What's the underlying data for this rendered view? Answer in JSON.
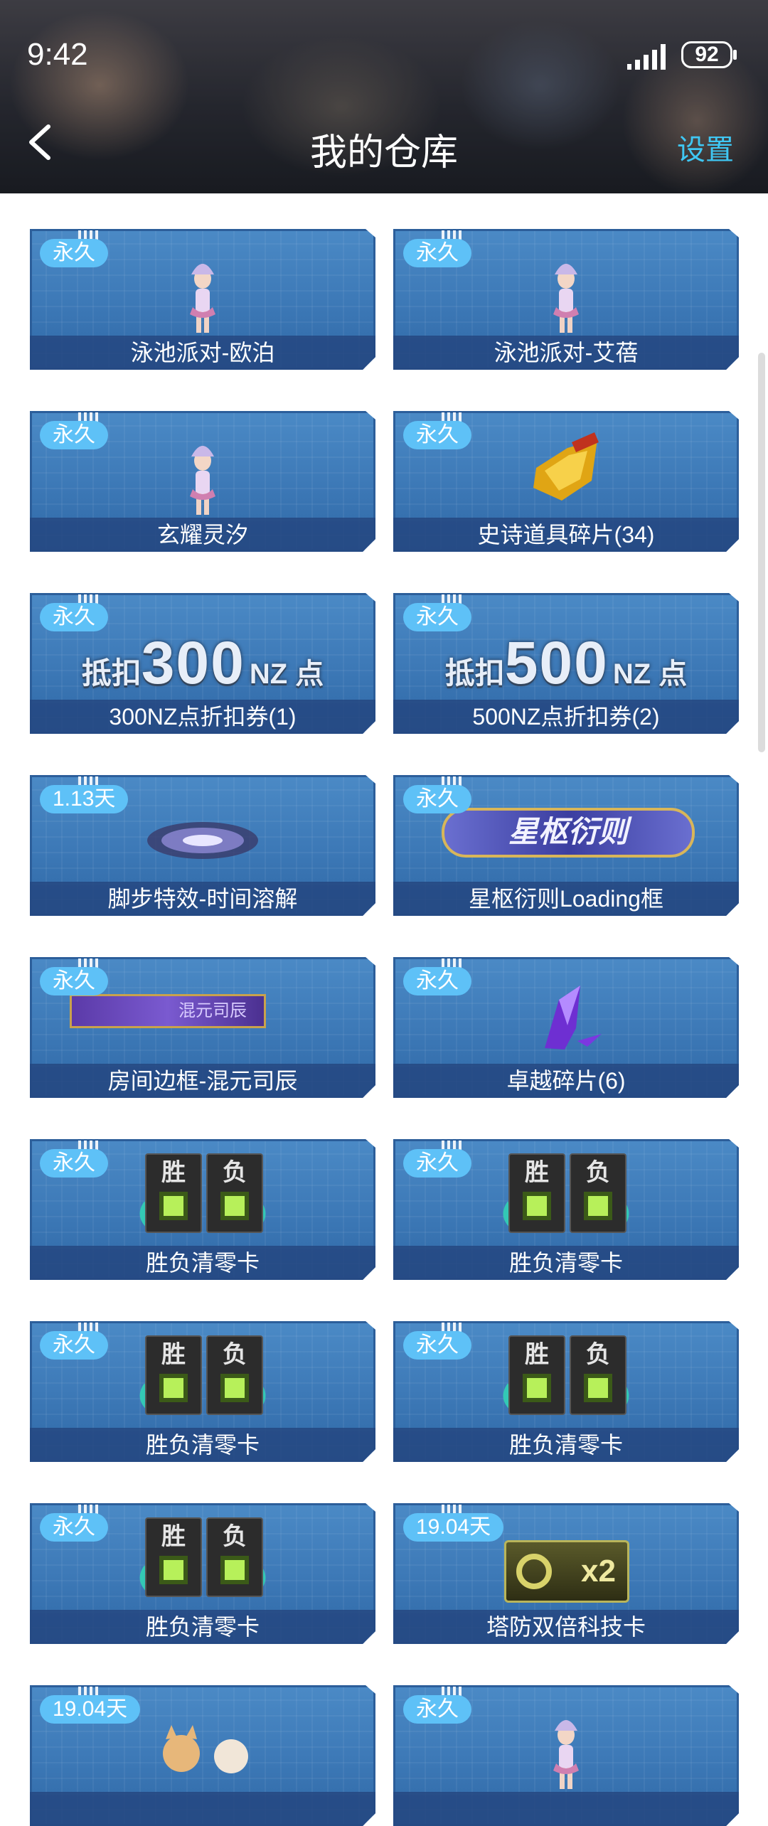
{
  "status": {
    "time": "9:42",
    "battery": "92"
  },
  "header": {
    "title": "我的仓库",
    "settings": "设置"
  },
  "items": [
    {
      "badge": "永久",
      "name": "泳池派对-欧泊",
      "art": "character-figure"
    },
    {
      "badge": "永久",
      "name": "泳池派对-艾蓓",
      "art": "character-figure"
    },
    {
      "badge": "永久",
      "name": "玄耀灵汐",
      "art": "character-figure"
    },
    {
      "badge": "永久",
      "name": "史诗道具碎片(34)",
      "art": "gold-shard"
    },
    {
      "badge": "永久",
      "name": "300NZ点折扣券(1)",
      "art": "coupon",
      "coupon": {
        "prefix": "抵扣",
        "value": "300",
        "unit": "NZ 点"
      }
    },
    {
      "badge": "永久",
      "name": "500NZ点折扣券(2)",
      "art": "coupon",
      "coupon": {
        "prefix": "抵扣",
        "value": "500",
        "unit": "NZ 点"
      }
    },
    {
      "badge": "1.13天",
      "name": "脚步特效-时间溶解",
      "art": "vortex"
    },
    {
      "badge": "永久",
      "name": "星枢衍则Loading框",
      "art": "loading-frame",
      "frame_text": "星枢衍则"
    },
    {
      "badge": "永久",
      "name": "房间边框-混元司辰",
      "art": "room-frame",
      "frame_text": "混元司辰"
    },
    {
      "badge": "永久",
      "name": "卓越碎片(6)",
      "art": "purple-crystal"
    },
    {
      "badge": "永久",
      "name": "胜负清零卡",
      "art": "reset-card",
      "card": {
        "win": "胜",
        "lose": "负"
      }
    },
    {
      "badge": "永久",
      "name": "胜负清零卡",
      "art": "reset-card",
      "card": {
        "win": "胜",
        "lose": "负"
      }
    },
    {
      "badge": "永久",
      "name": "胜负清零卡",
      "art": "reset-card",
      "card": {
        "win": "胜",
        "lose": "负"
      }
    },
    {
      "badge": "永久",
      "name": "胜负清零卡",
      "art": "reset-card",
      "card": {
        "win": "胜",
        "lose": "负"
      }
    },
    {
      "badge": "永久",
      "name": "胜负清零卡",
      "art": "reset-card",
      "card": {
        "win": "胜",
        "lose": "负"
      }
    },
    {
      "badge": "19.04天",
      "name": "塔防双倍科技卡",
      "art": "double-card",
      "card_text": "x2"
    },
    {
      "badge": "19.04天",
      "name": "",
      "art": "cat-pets"
    },
    {
      "badge": "永久",
      "name": "",
      "art": "character-figure"
    }
  ]
}
